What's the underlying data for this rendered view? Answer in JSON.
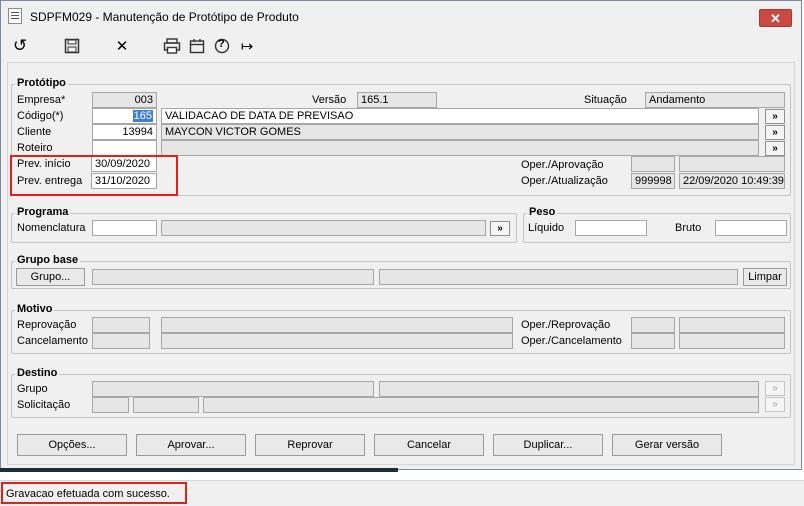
{
  "window": {
    "title": "SDPFM029 - Manutenção de Protótipo de Produto",
    "close_glyph": "✕"
  },
  "toolbar": {
    "icons": [
      "undo-icon",
      "save-icon",
      "delete-icon",
      "print-icon",
      "calendar-icon",
      "help-icon",
      "exit-icon"
    ],
    "glyphs": {
      "undo": "↺",
      "delete": "✕",
      "help": "?",
      "exit": "↦"
    }
  },
  "prototipo": {
    "title": "Protótipo",
    "empresa_label": "Empresa*",
    "empresa_value": "003",
    "versao_label": "Versão",
    "versao_value": "165.1",
    "situacao_label": "Situação",
    "situacao_value": "Andamento",
    "codigo_label": "Código(*)",
    "codigo_value": "165",
    "codigo_desc": "VALIDACAO DE DATA DE PREVISAO",
    "cliente_label": "Cliente",
    "cliente_value": "13994",
    "cliente_desc": "MAYCON VICTOR GOMES",
    "roteiro_label": "Roteiro",
    "prev_inicio_label": "Prev. início",
    "prev_inicio_value": "30/09/2020",
    "prev_entrega_label": "Prev. entrega",
    "prev_entrega_value": "31/10/2020",
    "oper_aprov_label": "Oper./Aprovação",
    "oper_atual_label": "Oper./Atualização",
    "oper_atual_value": "999998",
    "oper_atual_date": "22/09/2020 10:49:39",
    "arrow": "»"
  },
  "programa": {
    "title": "Programa",
    "nomenclatura_label": "Nomenclatura"
  },
  "peso": {
    "title": "Peso",
    "liquido_label": "Líquido",
    "bruto_label": "Bruto"
  },
  "grupo_base": {
    "title": "Grupo base",
    "grupo_button": "Grupo...",
    "limpar_button": "Limpar"
  },
  "motivo": {
    "title": "Motivo",
    "reprovacao_label": "Reprovação",
    "cancelamento_label": "Cancelamento",
    "oper_reprov_label": "Oper./Reprovação",
    "oper_cancel_label": "Oper./Cancelamento"
  },
  "destino": {
    "title": "Destino",
    "grupo_label": "Grupo",
    "solicitacao_label": "Solicitação"
  },
  "actions": {
    "opcoes": "Opções...",
    "aprovar": "Aprovar...",
    "reprovar": "Reprovar",
    "cancelar": "Cancelar",
    "duplicar": "Duplicar...",
    "gerar_versao": "Gerar versão"
  },
  "status": {
    "message": "Gravacao efetuada com sucesso."
  }
}
